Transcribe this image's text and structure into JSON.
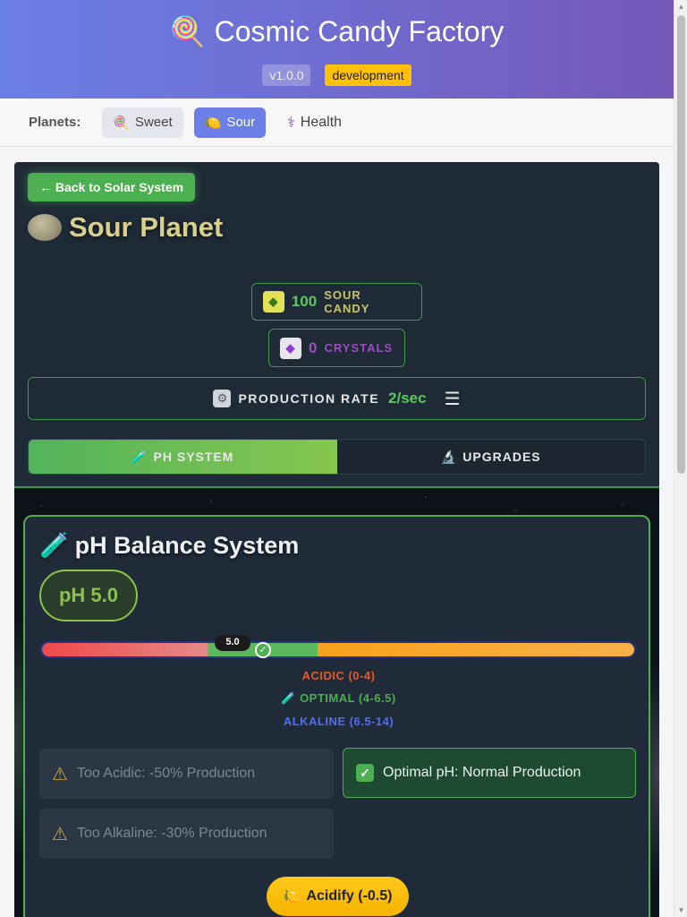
{
  "header": {
    "title": "Cosmic Candy Factory",
    "title_icon": "lollipop-icon",
    "version": "v1.0.0",
    "environment": "development"
  },
  "planet_nav": {
    "label": "Planets:",
    "items": [
      {
        "label": "Sweet",
        "icon": "lollipop-icon",
        "active": false
      },
      {
        "label": "Sour",
        "icon": "lemon-icon",
        "active": true
      },
      {
        "label": "Health",
        "icon": "caduceus-icon",
        "active": false
      }
    ]
  },
  "planet": {
    "back_label": "← Back to Solar System",
    "name": "Sour Planet",
    "resources": {
      "candy": {
        "value": "100",
        "label": "SOUR CANDY",
        "icon": "sour-candy-icon"
      },
      "crystals": {
        "value": "0",
        "label": "CRYSTALS",
        "icon": "crystal-icon"
      }
    },
    "production": {
      "label": "PRODUCTION RATE",
      "rate": "2/sec",
      "icon": "gear-icon"
    },
    "tabs": [
      {
        "label": "PH SYSTEM",
        "icon": "test-tube-icon",
        "active": true
      },
      {
        "label": "UPGRADES",
        "icon": "microscope-icon",
        "active": false
      }
    ]
  },
  "ph_system": {
    "title": "pH Balance System",
    "current": "pH 5.0",
    "marker_value": "5.0",
    "marker_level": 5.0,
    "ranges": {
      "acidic": "ACIDIC (0-4)",
      "optimal": "🧪 OPTIMAL (4-6.5)",
      "alkaline": "ALKALINE (6.5-14)"
    },
    "effects": {
      "too_acidic": "Too Acidic: -50% Production",
      "optimal": "Optimal pH: Normal Production",
      "too_alkaline": "Too Alkaline: -30% Production"
    },
    "acidify_label": "Acidify (-0.5)"
  },
  "colors": {
    "accent_green": "#4caf50",
    "header_start": "#6a7fe6",
    "header_end": "#7558b8",
    "env_badge": "#ffc107"
  }
}
